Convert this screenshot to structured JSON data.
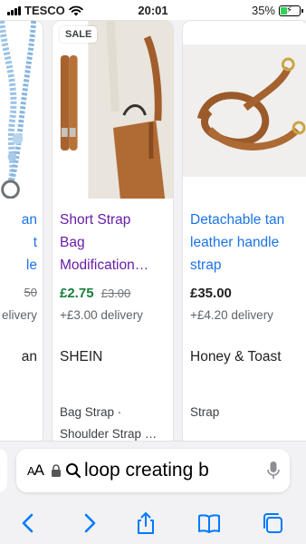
{
  "status_bar": {
    "carrier": "TESCO",
    "time": "20:01",
    "battery_percent": "35%",
    "battery_level": 0.35
  },
  "cards": [
    {
      "title_lines": [
        "an",
        "t",
        "le"
      ],
      "price_text": "50",
      "delivery": "elivery",
      "seller": "an"
    },
    {
      "badge": "SALE",
      "title_lines": [
        "Short Strap",
        "Bag",
        "Modification…"
      ],
      "price": "£2.75",
      "old_price": "£3.00",
      "delivery": "+£3.00 delivery",
      "seller": "SHEIN",
      "category_lines": [
        "Bag Strap ·",
        "Shoulder Strap …"
      ]
    },
    {
      "title_lines": [
        "Detachable tan",
        "leather handle",
        "strap"
      ],
      "price": "£35.00",
      "delivery": "+£4.20 delivery",
      "seller": "Honey & Toast",
      "category_lines": [
        "Strap"
      ]
    }
  ],
  "browser": {
    "text_size_label": "AA",
    "url_text": "loop creating b",
    "icons": [
      "lock-icon",
      "search-icon",
      "microphone-icon",
      "back-icon",
      "forward-icon",
      "share-icon",
      "bookmarks-icon",
      "tabs-icon"
    ]
  },
  "colors": {
    "link_blue": "#1a73e8",
    "visited_purple": "#681da8",
    "sale_green": "#188038",
    "ios_blue": "#007aff"
  }
}
